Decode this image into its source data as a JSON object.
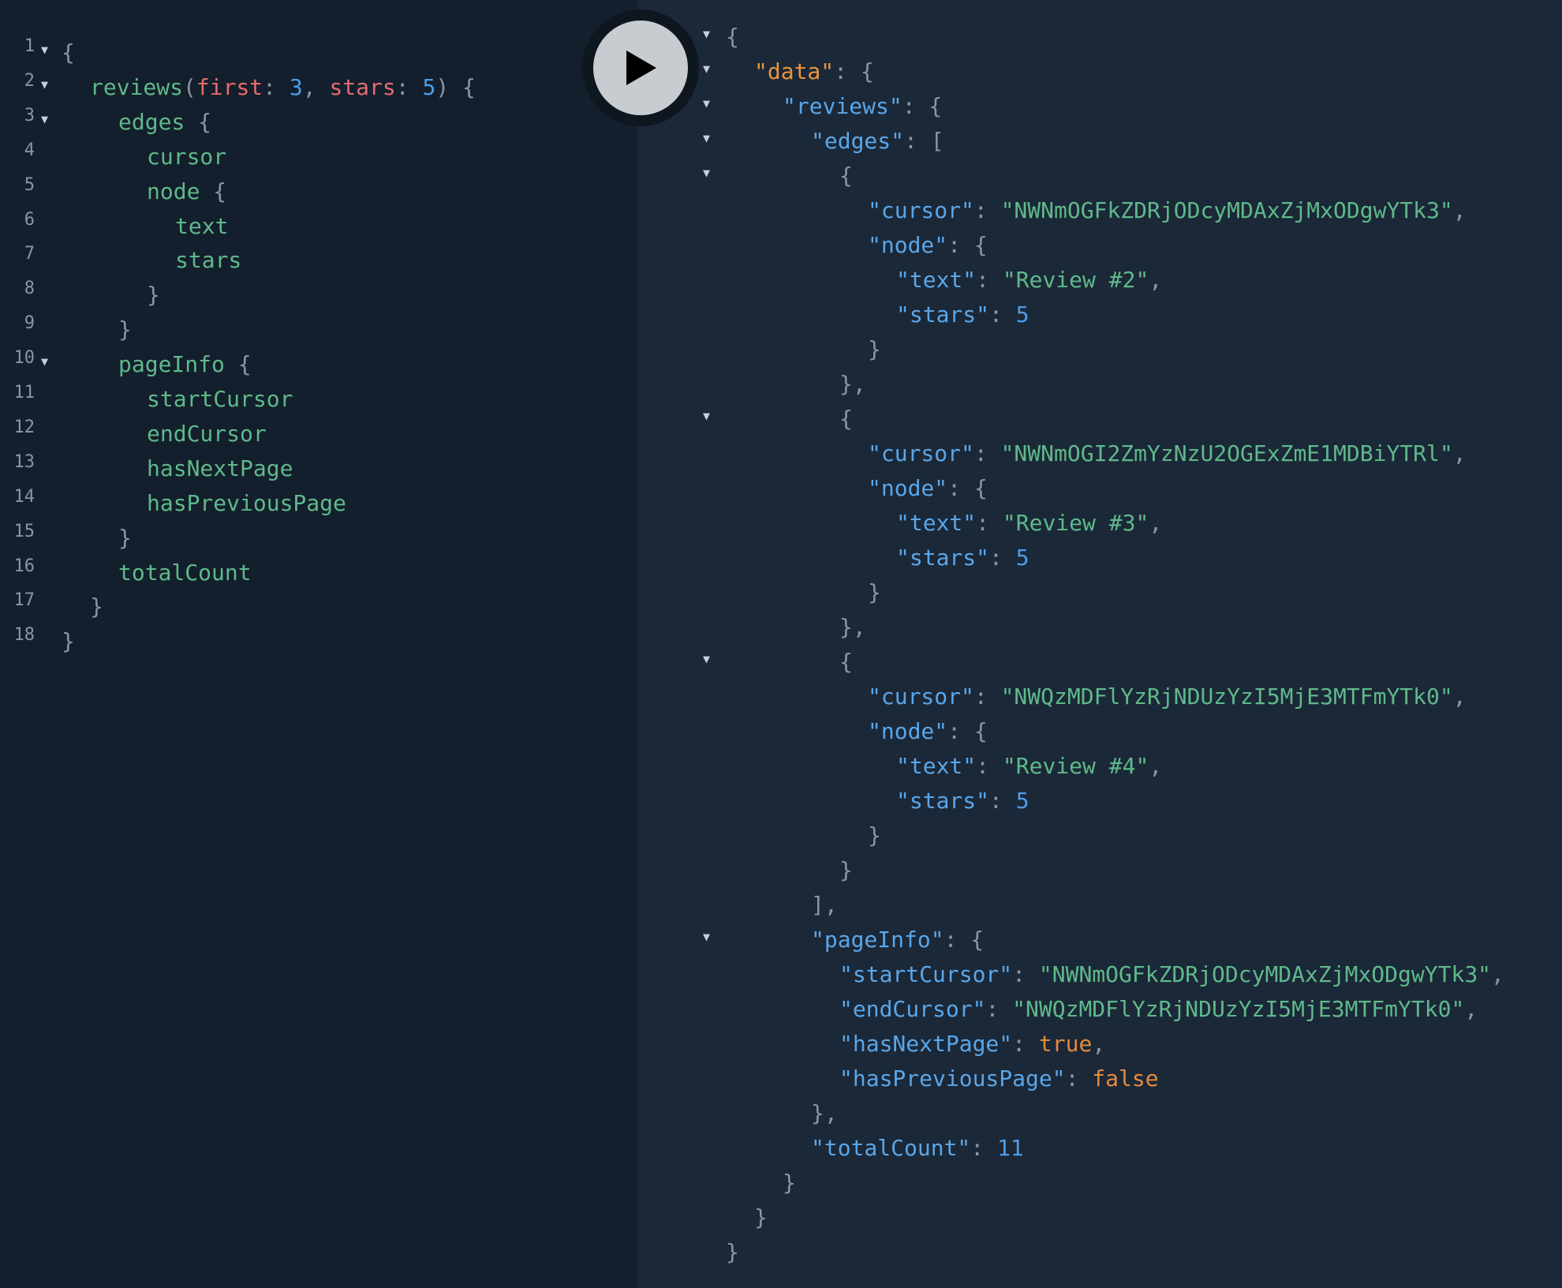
{
  "accent_colors": {
    "query_bg": "#131f2c",
    "result_bg": "#1b2838",
    "field": "#5fb98a",
    "argument": "#e56b6f",
    "number": "#4d9de8",
    "key": "#5aa6e8",
    "boolean": "#e38a3c"
  },
  "run_button": {
    "icon": "play-icon"
  },
  "query": {
    "lines": [
      {
        "n": "1",
        "fold": true,
        "indent": 0,
        "tokens": [
          {
            "t": "{",
            "c": "punct"
          }
        ]
      },
      {
        "n": "2",
        "fold": true,
        "indent": 1,
        "tokens": [
          {
            "t": "reviews",
            "c": "field"
          },
          {
            "t": "(",
            "c": "punct"
          },
          {
            "t": "first",
            "c": "arg"
          },
          {
            "t": ": ",
            "c": "punct"
          },
          {
            "t": "3",
            "c": "num"
          },
          {
            "t": ", ",
            "c": "punct"
          },
          {
            "t": "stars",
            "c": "arg"
          },
          {
            "t": ": ",
            "c": "punct"
          },
          {
            "t": "5",
            "c": "num"
          },
          {
            "t": ") {",
            "c": "punct"
          }
        ]
      },
      {
        "n": "3",
        "fold": true,
        "indent": 2,
        "tokens": [
          {
            "t": "edges",
            "c": "field"
          },
          {
            "t": " {",
            "c": "punct"
          }
        ]
      },
      {
        "n": "4",
        "fold": false,
        "indent": 3,
        "tokens": [
          {
            "t": "cursor",
            "c": "field"
          }
        ]
      },
      {
        "n": "5",
        "fold": false,
        "indent": 3,
        "tokens": [
          {
            "t": "node",
            "c": "field"
          },
          {
            "t": " {",
            "c": "punct"
          }
        ]
      },
      {
        "n": "6",
        "fold": false,
        "indent": 4,
        "tokens": [
          {
            "t": "text",
            "c": "field"
          }
        ]
      },
      {
        "n": "7",
        "fold": false,
        "indent": 4,
        "tokens": [
          {
            "t": "stars",
            "c": "field"
          }
        ]
      },
      {
        "n": "8",
        "fold": false,
        "indent": 3,
        "tokens": [
          {
            "t": "}",
            "c": "punct"
          }
        ]
      },
      {
        "n": "9",
        "fold": false,
        "indent": 2,
        "tokens": [
          {
            "t": "}",
            "c": "punct"
          }
        ]
      },
      {
        "n": "10",
        "fold": true,
        "indent": 2,
        "tokens": [
          {
            "t": "pageInfo",
            "c": "field"
          },
          {
            "t": " {",
            "c": "punct"
          }
        ]
      },
      {
        "n": "11",
        "fold": false,
        "indent": 3,
        "tokens": [
          {
            "t": "startCursor",
            "c": "field"
          }
        ]
      },
      {
        "n": "12",
        "fold": false,
        "indent": 3,
        "tokens": [
          {
            "t": "endCursor",
            "c": "field"
          }
        ]
      },
      {
        "n": "13",
        "fold": false,
        "indent": 3,
        "tokens": [
          {
            "t": "hasNextPage",
            "c": "field"
          }
        ]
      },
      {
        "n": "14",
        "fold": false,
        "indent": 3,
        "tokens": [
          {
            "t": "hasPreviousPage",
            "c": "field"
          }
        ]
      },
      {
        "n": "15",
        "fold": false,
        "indent": 2,
        "tokens": [
          {
            "t": "}",
            "c": "punct"
          }
        ]
      },
      {
        "n": "16",
        "fold": false,
        "indent": 2,
        "tokens": [
          {
            "t": "totalCount",
            "c": "field"
          }
        ]
      },
      {
        "n": "17",
        "fold": false,
        "indent": 1,
        "tokens": [
          {
            "t": "}",
            "c": "punct"
          }
        ]
      },
      {
        "n": "18",
        "fold": false,
        "indent": 0,
        "tokens": [
          {
            "t": "}",
            "c": "punct"
          }
        ]
      }
    ]
  },
  "result": {
    "lines": [
      {
        "fold": true,
        "indent": 0,
        "tokens": [
          {
            "t": "{",
            "c": "punct"
          }
        ]
      },
      {
        "fold": true,
        "indent": 1,
        "tokens": [
          {
            "t": "\"data\"",
            "c": "datakey"
          },
          {
            "t": ": {",
            "c": "punct"
          }
        ]
      },
      {
        "fold": true,
        "indent": 2,
        "tokens": [
          {
            "t": "\"reviews\"",
            "c": "key"
          },
          {
            "t": ": {",
            "c": "punct"
          }
        ]
      },
      {
        "fold": true,
        "indent": 3,
        "tokens": [
          {
            "t": "\"edges\"",
            "c": "key"
          },
          {
            "t": ": [",
            "c": "punct"
          }
        ]
      },
      {
        "fold": true,
        "indent": 4,
        "tokens": [
          {
            "t": "{",
            "c": "punct"
          }
        ]
      },
      {
        "fold": false,
        "indent": 5,
        "tokens": [
          {
            "t": "\"cursor\"",
            "c": "key"
          },
          {
            "t": ": ",
            "c": "punct"
          },
          {
            "t": "\"NWNmOGFkZDRjODcyMDAxZjMxODgwYTk3\"",
            "c": "str"
          },
          {
            "t": ",",
            "c": "punct"
          }
        ]
      },
      {
        "fold": false,
        "indent": 5,
        "tokens": [
          {
            "t": "\"node\"",
            "c": "key"
          },
          {
            "t": ": {",
            "c": "punct"
          }
        ]
      },
      {
        "fold": false,
        "indent": 6,
        "tokens": [
          {
            "t": "\"text\"",
            "c": "key"
          },
          {
            "t": ": ",
            "c": "punct"
          },
          {
            "t": "\"Review #2\"",
            "c": "str"
          },
          {
            "t": ",",
            "c": "punct"
          }
        ]
      },
      {
        "fold": false,
        "indent": 6,
        "tokens": [
          {
            "t": "\"stars\"",
            "c": "key"
          },
          {
            "t": ": ",
            "c": "punct"
          },
          {
            "t": "5",
            "c": "num"
          }
        ]
      },
      {
        "fold": false,
        "indent": 5,
        "tokens": [
          {
            "t": "}",
            "c": "punct"
          }
        ]
      },
      {
        "fold": false,
        "indent": 4,
        "tokens": [
          {
            "t": "},",
            "c": "punct"
          }
        ]
      },
      {
        "fold": true,
        "indent": 4,
        "tokens": [
          {
            "t": "{",
            "c": "punct"
          }
        ]
      },
      {
        "fold": false,
        "indent": 5,
        "tokens": [
          {
            "t": "\"cursor\"",
            "c": "key"
          },
          {
            "t": ": ",
            "c": "punct"
          },
          {
            "t": "\"NWNmOGI2ZmYzNzU2OGExZmE1MDBiYTRl\"",
            "c": "str"
          },
          {
            "t": ",",
            "c": "punct"
          }
        ]
      },
      {
        "fold": false,
        "indent": 5,
        "tokens": [
          {
            "t": "\"node\"",
            "c": "key"
          },
          {
            "t": ": {",
            "c": "punct"
          }
        ]
      },
      {
        "fold": false,
        "indent": 6,
        "tokens": [
          {
            "t": "\"text\"",
            "c": "key"
          },
          {
            "t": ": ",
            "c": "punct"
          },
          {
            "t": "\"Review #3\"",
            "c": "str"
          },
          {
            "t": ",",
            "c": "punct"
          }
        ]
      },
      {
        "fold": false,
        "indent": 6,
        "tokens": [
          {
            "t": "\"stars\"",
            "c": "key"
          },
          {
            "t": ": ",
            "c": "punct"
          },
          {
            "t": "5",
            "c": "num"
          }
        ]
      },
      {
        "fold": false,
        "indent": 5,
        "tokens": [
          {
            "t": "}",
            "c": "punct"
          }
        ]
      },
      {
        "fold": false,
        "indent": 4,
        "tokens": [
          {
            "t": "},",
            "c": "punct"
          }
        ]
      },
      {
        "fold": true,
        "indent": 4,
        "tokens": [
          {
            "t": "{",
            "c": "punct"
          }
        ]
      },
      {
        "fold": false,
        "indent": 5,
        "tokens": [
          {
            "t": "\"cursor\"",
            "c": "key"
          },
          {
            "t": ": ",
            "c": "punct"
          },
          {
            "t": "\"NWQzMDFlYzRjNDUzYzI5MjE3MTFmYTk0\"",
            "c": "str"
          },
          {
            "t": ",",
            "c": "punct"
          }
        ]
      },
      {
        "fold": false,
        "indent": 5,
        "tokens": [
          {
            "t": "\"node\"",
            "c": "key"
          },
          {
            "t": ": {",
            "c": "punct"
          }
        ]
      },
      {
        "fold": false,
        "indent": 6,
        "tokens": [
          {
            "t": "\"text\"",
            "c": "key"
          },
          {
            "t": ": ",
            "c": "punct"
          },
          {
            "t": "\"Review #4\"",
            "c": "str"
          },
          {
            "t": ",",
            "c": "punct"
          }
        ]
      },
      {
        "fold": false,
        "indent": 6,
        "tokens": [
          {
            "t": "\"stars\"",
            "c": "key"
          },
          {
            "t": ": ",
            "c": "punct"
          },
          {
            "t": "5",
            "c": "num"
          }
        ]
      },
      {
        "fold": false,
        "indent": 5,
        "tokens": [
          {
            "t": "}",
            "c": "punct"
          }
        ]
      },
      {
        "fold": false,
        "indent": 4,
        "tokens": [
          {
            "t": "}",
            "c": "punct"
          }
        ]
      },
      {
        "fold": false,
        "indent": 3,
        "tokens": [
          {
            "t": "],",
            "c": "punct"
          }
        ]
      },
      {
        "fold": true,
        "indent": 3,
        "tokens": [
          {
            "t": "\"pageInfo\"",
            "c": "key"
          },
          {
            "t": ": {",
            "c": "punct"
          }
        ]
      },
      {
        "fold": false,
        "indent": 4,
        "tokens": [
          {
            "t": "\"startCursor\"",
            "c": "key"
          },
          {
            "t": ": ",
            "c": "punct"
          },
          {
            "t": "\"NWNmOGFkZDRjODcyMDAxZjMxODgwYTk3\"",
            "c": "str"
          },
          {
            "t": ",",
            "c": "punct"
          }
        ]
      },
      {
        "fold": false,
        "indent": 4,
        "tokens": [
          {
            "t": "\"endCursor\"",
            "c": "key"
          },
          {
            "t": ": ",
            "c": "punct"
          },
          {
            "t": "\"NWQzMDFlYzRjNDUzYzI5MjE3MTFmYTk0\"",
            "c": "str"
          },
          {
            "t": ",",
            "c": "punct"
          }
        ]
      },
      {
        "fold": false,
        "indent": 4,
        "tokens": [
          {
            "t": "\"hasNextPage\"",
            "c": "key"
          },
          {
            "t": ": ",
            "c": "punct"
          },
          {
            "t": "true",
            "c": "bool"
          },
          {
            "t": ",",
            "c": "punct"
          }
        ]
      },
      {
        "fold": false,
        "indent": 4,
        "tokens": [
          {
            "t": "\"hasPreviousPage\"",
            "c": "key"
          },
          {
            "t": ": ",
            "c": "punct"
          },
          {
            "t": "false",
            "c": "bool"
          }
        ]
      },
      {
        "fold": false,
        "indent": 3,
        "tokens": [
          {
            "t": "},",
            "c": "punct"
          }
        ]
      },
      {
        "fold": false,
        "indent": 3,
        "tokens": [
          {
            "t": "\"totalCount\"",
            "c": "key"
          },
          {
            "t": ": ",
            "c": "punct"
          },
          {
            "t": "11",
            "c": "num"
          }
        ]
      },
      {
        "fold": false,
        "indent": 2,
        "tokens": [
          {
            "t": "}",
            "c": "punct"
          }
        ]
      },
      {
        "fold": false,
        "indent": 1,
        "tokens": [
          {
            "t": "}",
            "c": "punct"
          }
        ]
      },
      {
        "fold": false,
        "indent": 0,
        "tokens": [
          {
            "t": "}",
            "c": "punct"
          }
        ]
      }
    ]
  }
}
